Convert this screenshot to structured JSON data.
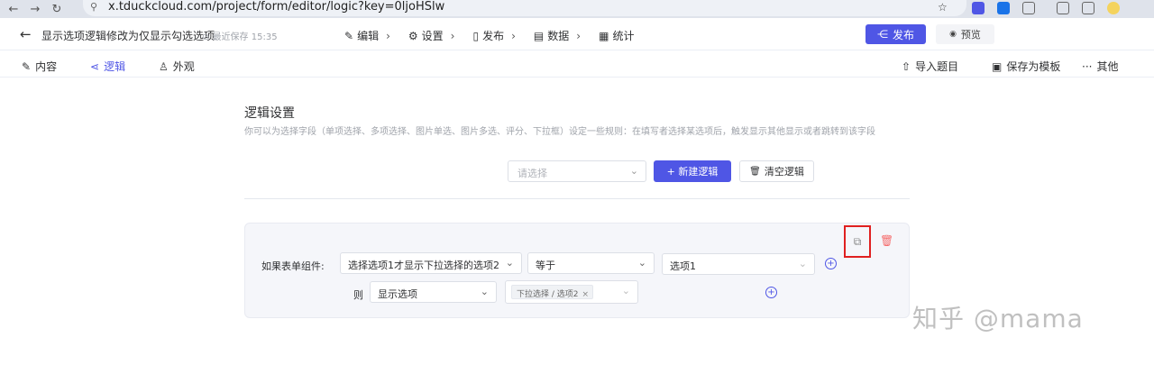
{
  "browser": {
    "url": "x.tduckcloud.com/project/form/editor/logic?key=0ljoHSlw",
    "back_icon": "←",
    "forward_icon": "→",
    "reload_icon": "↻",
    "site_icon": "⚲",
    "star_icon": "☆"
  },
  "header": {
    "back_icon": "←",
    "form_title": "显示选项逻辑修改为仅显示勾选选项",
    "save_status": "⊘ 最近保存 15:35",
    "steps": [
      {
        "icon": "✎",
        "label": "编辑",
        "chevron": "›"
      },
      {
        "icon": "⚙",
        "label": "设置",
        "chevron": "›"
      },
      {
        "icon": "▯",
        "label": "发布",
        "chevron": "›"
      },
      {
        "icon": "▤",
        "label": "数据",
        "chevron": "›"
      },
      {
        "icon": "▦",
        "label": "统计",
        "chevron": ""
      }
    ],
    "publish_label": "发布",
    "publish_icon": "⋲",
    "preview_label": "预览",
    "preview_icon": "◉"
  },
  "toolbar": {
    "content": {
      "icon": "✎",
      "label": "内容"
    },
    "logic": {
      "icon": "⋖",
      "label": "逻辑"
    },
    "appearance": {
      "icon": "♙",
      "label": "外观"
    },
    "import": {
      "icon": "⇧",
      "label": "导入题目"
    },
    "save_template": {
      "icon": "▣",
      "label": "保存为模板"
    },
    "more": {
      "icon": "···",
      "label": "其他"
    }
  },
  "logic": {
    "title": "逻辑设置",
    "description": "你可以为选择字段（单项选择、多项选择、图片单选、图片多选、评分、下拉框）设定一些规则：在填写者选择某选项后，触发显示其他显示或者跳转到该字段",
    "select_placeholder": "请选择",
    "new_logic_label": "+  新建逻辑",
    "clear_logic_label": "清空逻辑",
    "clear_icon": "🗑"
  },
  "rule": {
    "condition_label": "如果表单组件:",
    "component_value": "选择选项1才显示下拉选择的选项2",
    "operator_value": "等于",
    "option_value": "选项1",
    "then_label": "则",
    "action_value": "显示选项",
    "target_tag": "下拉选择 / 选项2",
    "tag_close": "×",
    "chevron": "⌄",
    "add_icon": "+",
    "copy_icon": "⧉",
    "delete_icon": "🗑"
  },
  "watermark": "知乎 @mama",
  "colors": {
    "accent": "#4f56e5",
    "highlight_box": "#e02020",
    "delete": "#f56c6c",
    "card_bg": "#f5f6fa"
  }
}
